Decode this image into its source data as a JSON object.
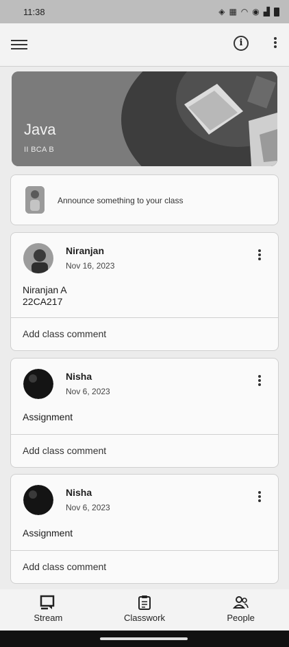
{
  "status_bar": {
    "time": "11:38"
  },
  "class_banner": {
    "title": "Java",
    "section": "II BCA B"
  },
  "announce": {
    "placeholder": "Announce something to your class"
  },
  "posts": [
    {
      "author": "Niranjan",
      "date": "Nov 16, 2023",
      "body_line1": "Niranjan A",
      "body_line2": "22CA217",
      "comment_label": "Add class comment"
    },
    {
      "author": "Nisha",
      "date": "Nov 6, 2023",
      "body_line1": "Assignment",
      "comment_label": "Add class comment"
    },
    {
      "author": "Nisha",
      "date": "Nov 6, 2023",
      "body_line1": "Assignment",
      "comment_label": "Add class comment"
    }
  ],
  "bottom_nav": [
    {
      "label": "Stream",
      "icon": "stream-icon"
    },
    {
      "label": "Classwork",
      "icon": "classwork-icon"
    },
    {
      "label": "People",
      "icon": "people-icon"
    }
  ]
}
